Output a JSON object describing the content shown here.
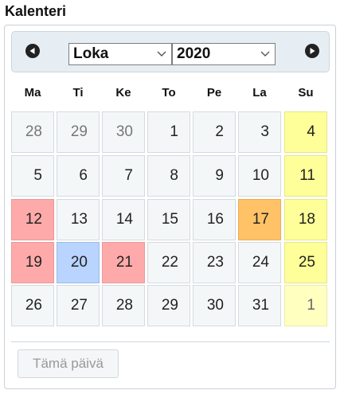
{
  "title": "Kalenteri",
  "header": {
    "prev_icon": "chevron-left-circle-icon",
    "next_icon": "chevron-right-circle-icon",
    "month_value": "Loka",
    "year_value": "2020"
  },
  "weekdays": [
    "Ma",
    "Ti",
    "Ke",
    "To",
    "Pe",
    "La",
    "Su"
  ],
  "weeks": [
    [
      {
        "d": "28",
        "s": "other"
      },
      {
        "d": "29",
        "s": "other"
      },
      {
        "d": "30",
        "s": "other"
      },
      {
        "d": "1",
        "s": ""
      },
      {
        "d": "2",
        "s": ""
      },
      {
        "d": "3",
        "s": ""
      },
      {
        "d": "4",
        "s": "sun"
      }
    ],
    [
      {
        "d": "5",
        "s": ""
      },
      {
        "d": "6",
        "s": ""
      },
      {
        "d": "7",
        "s": ""
      },
      {
        "d": "8",
        "s": ""
      },
      {
        "d": "9",
        "s": ""
      },
      {
        "d": "10",
        "s": ""
      },
      {
        "d": "11",
        "s": "sun"
      }
    ],
    [
      {
        "d": "12",
        "s": "holiday"
      },
      {
        "d": "13",
        "s": ""
      },
      {
        "d": "14",
        "s": ""
      },
      {
        "d": "15",
        "s": ""
      },
      {
        "d": "16",
        "s": ""
      },
      {
        "d": "17",
        "s": "special"
      },
      {
        "d": "18",
        "s": "sun"
      }
    ],
    [
      {
        "d": "19",
        "s": "holiday"
      },
      {
        "d": "20",
        "s": "today"
      },
      {
        "d": "21",
        "s": "holiday"
      },
      {
        "d": "22",
        "s": ""
      },
      {
        "d": "23",
        "s": ""
      },
      {
        "d": "24",
        "s": ""
      },
      {
        "d": "25",
        "s": "sun"
      }
    ],
    [
      {
        "d": "26",
        "s": ""
      },
      {
        "d": "27",
        "s": ""
      },
      {
        "d": "28",
        "s": ""
      },
      {
        "d": "29",
        "s": ""
      },
      {
        "d": "30",
        "s": ""
      },
      {
        "d": "31",
        "s": ""
      },
      {
        "d": "1",
        "s": "sun-other"
      }
    ]
  ],
  "footer": {
    "today_label": "Tämä päivä"
  },
  "colors": {
    "sunday": "#ffff99",
    "holiday": "#ffaaaa",
    "special": "#ffc266",
    "today": "#b8d4ff"
  }
}
